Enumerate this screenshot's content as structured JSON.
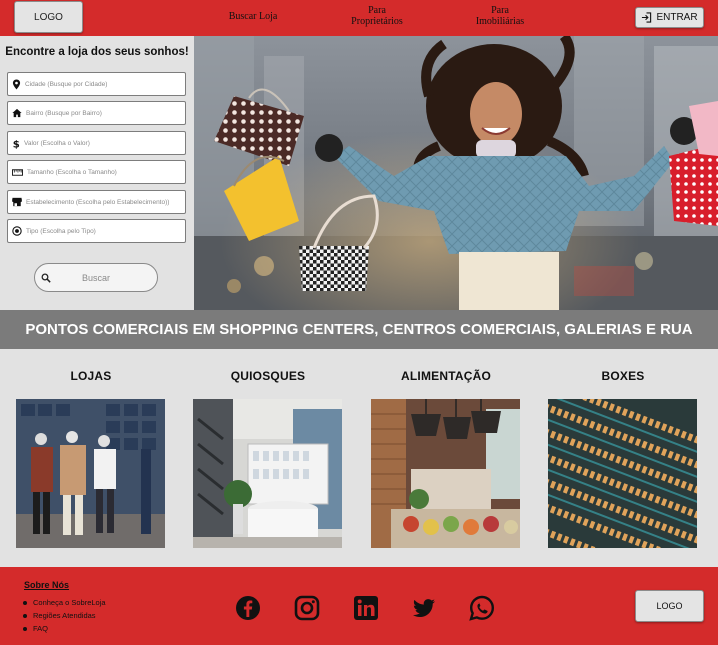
{
  "colors": {
    "brand_red": "#d42b2b",
    "panel_gray": "#e2e2e2",
    "banner_gray": "#7b7b7b"
  },
  "header": {
    "logo_label": "LOGO",
    "nav": {
      "buscar_loja": "Buscar Loja",
      "para": "Para",
      "proprietarios": "Proprietários",
      "imobiliarias": "Imobiliárias"
    },
    "login_label": "ENTRAR",
    "login_icon": "login-icon"
  },
  "search": {
    "title": "Encontre a loja dos seus sonhos!",
    "fields": [
      {
        "icon": "location-pin-icon",
        "placeholder": "Cidade (Busque por Cidade)"
      },
      {
        "icon": "home-icon",
        "placeholder": "Bairro (Busque por Bairro)"
      },
      {
        "icon": "dollar-icon",
        "placeholder": "Valor (Escolha o Valor)"
      },
      {
        "icon": "ruler-icon",
        "placeholder": "Tamanho (Escolha o Tamanho)"
      },
      {
        "icon": "store-icon",
        "placeholder": "Estabelecimento (Escolha pelo Estabelecimento))"
      },
      {
        "icon": "target-icon",
        "placeholder": "Tipo (Escolha pelo Tipo)"
      }
    ],
    "button_label": "Buscar"
  },
  "banner": {
    "text": "PONTOS COMERCIAIS EM SHOPPING CENTERS, CENTROS COMERCIAIS, GALERIAS E RUA"
  },
  "categories": [
    {
      "label": "LOJAS"
    },
    {
      "label": "QUIOSQUES"
    },
    {
      "label": "ALIMENTAÇÃO"
    },
    {
      "label": "BOXES"
    }
  ],
  "footer": {
    "about_title": "Sobre Nós",
    "links": [
      "Conheça o SobreLoja",
      "Regiões Atendidas",
      "FAQ"
    ],
    "social_icons": [
      "facebook-icon",
      "instagram-icon",
      "linkedin-icon",
      "twitter-icon",
      "whatsapp-icon"
    ],
    "logo_label": "LOGO"
  }
}
